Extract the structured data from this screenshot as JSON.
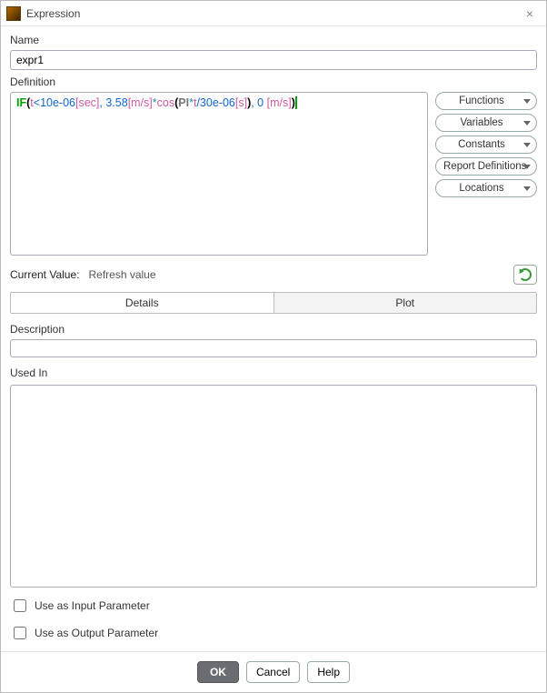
{
  "window": {
    "title": "Expression"
  },
  "labels": {
    "name": "Name",
    "definition": "Definition",
    "current_value": "Current Value:",
    "description": "Description",
    "used_in": "Used In",
    "input_param": "Use as Input Parameter",
    "output_param": "Use as Output Parameter"
  },
  "fields": {
    "name_value": "expr1",
    "description_value": "",
    "current_value_text": "Refresh value"
  },
  "definition": {
    "raw": "IF(t<10e-06[sec], 3.58[m/s]*cos(PI*t/30e-06[s]), 0 [m/s])",
    "tokens": [
      {
        "cls": "tok-kw",
        "t": "IF"
      },
      {
        "cls": "tok-par",
        "t": "("
      },
      {
        "cls": "tok-var",
        "t": "t"
      },
      {
        "cls": "tok-num",
        "t": "<10e-06"
      },
      {
        "cls": "tok-unit",
        "t": "[sec]"
      },
      {
        "cls": "tok-num",
        "t": ", 3.58"
      },
      {
        "cls": "tok-unit",
        "t": "[m/s]"
      },
      {
        "cls": "tok-op",
        "t": "*"
      },
      {
        "cls": "tok-func",
        "t": "cos"
      },
      {
        "cls": "tok-par",
        "t": "("
      },
      {
        "cls": "tok-const",
        "t": "PI"
      },
      {
        "cls": "tok-op",
        "t": "*"
      },
      {
        "cls": "tok-var",
        "t": "t"
      },
      {
        "cls": "tok-num",
        "t": "/30e-06"
      },
      {
        "cls": "tok-unit",
        "t": "[s]"
      },
      {
        "cls": "tok-par",
        "t": ")"
      },
      {
        "cls": "tok-num",
        "t": ", 0 "
      },
      {
        "cls": "tok-unit",
        "t": "[m/s]"
      },
      {
        "cls": "tok-par",
        "t": ")"
      },
      {
        "cls": "tok-cursor",
        "t": " "
      }
    ]
  },
  "side_buttons": [
    {
      "label": "Functions"
    },
    {
      "label": "Variables"
    },
    {
      "label": "Constants"
    },
    {
      "label": "Report Definitions"
    },
    {
      "label": "Locations"
    }
  ],
  "tabs": {
    "details": "Details",
    "plot": "Plot",
    "active": "details"
  },
  "checkboxes": {
    "input_param_checked": false,
    "output_param_checked": false
  },
  "footer": {
    "ok": "OK",
    "cancel": "Cancel",
    "help": "Help"
  }
}
